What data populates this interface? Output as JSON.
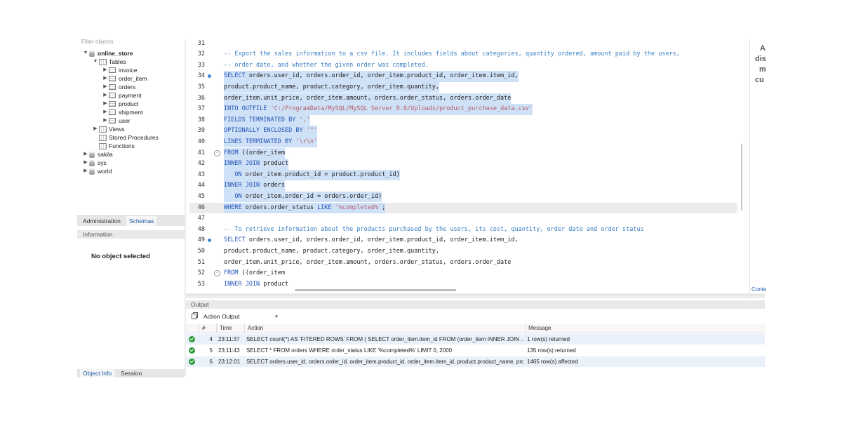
{
  "navigator": {
    "filter_placeholder": "Filter objects",
    "tree": [
      {
        "label": "online_store",
        "icon": "database-icon",
        "expanded": true,
        "bold": true
      },
      {
        "label": "Tables",
        "icon": "tables-folder-icon",
        "expanded": true
      },
      {
        "label": "invoice",
        "icon": "table-icon"
      },
      {
        "label": "order_item",
        "icon": "table-icon"
      },
      {
        "label": "orders",
        "icon": "table-icon"
      },
      {
        "label": "payment",
        "icon": "table-icon"
      },
      {
        "label": "product",
        "icon": "table-icon"
      },
      {
        "label": "shipment",
        "icon": "table-icon"
      },
      {
        "label": "user",
        "icon": "table-icon"
      },
      {
        "label": "Views",
        "icon": "views-folder-icon"
      },
      {
        "label": "Stored Procedures",
        "icon": "procedures-folder-icon"
      },
      {
        "label": "Functions",
        "icon": "functions-folder-icon"
      },
      {
        "label": "sakila",
        "icon": "database-icon"
      },
      {
        "label": "sys",
        "icon": "database-icon"
      },
      {
        "label": "world",
        "icon": "database-icon"
      }
    ],
    "tabs": [
      "Administration",
      "Schemas"
    ],
    "active_tab": "Schemas"
  },
  "information": {
    "header": "Information",
    "empty_text": "No object selected",
    "tabs": [
      "Object Info",
      "Session"
    ],
    "active_tab": "Object Info"
  },
  "editor": {
    "lines": [
      {
        "num": "31",
        "segs": []
      },
      {
        "num": "32",
        "segs": [
          {
            "t": "-- Export the sales information to a csv file. It includes fields about categories, quantity ordered, amount paid by the users,",
            "c": "cmt"
          }
        ]
      },
      {
        "num": "33",
        "segs": [
          {
            "t": "-- order date, and whether the given order was completed.",
            "c": "cmt"
          }
        ]
      },
      {
        "num": "34",
        "dot": true,
        "sel": true,
        "segs": [
          {
            "t": "SELECT",
            "c": "kw"
          },
          {
            "t": " orders.user_id, orders.order_id, order_item.product_id, order_item.item_id,"
          }
        ]
      },
      {
        "num": "35",
        "sel": true,
        "segs": [
          {
            "t": "product.product_name, product.category, order_item.quantity,"
          }
        ]
      },
      {
        "num": "36",
        "sel": true,
        "segs": [
          {
            "t": "order_item.unit_price, order_item.amount, orders.order_status, orders.order_date"
          }
        ]
      },
      {
        "num": "37",
        "sel": true,
        "segs": [
          {
            "t": "INTO OUTFILE",
            "c": "kw"
          },
          {
            "t": " "
          },
          {
            "t": "'C:/ProgramData/MySQL/MySQL Server 8.0/Uploads/product_purchase_data.csv'",
            "c": "str"
          }
        ]
      },
      {
        "num": "38",
        "sel": true,
        "segs": [
          {
            "t": "FIELDS TERMINATED BY",
            "c": "kw"
          },
          {
            "t": " "
          },
          {
            "t": "','",
            "c": "str"
          }
        ]
      },
      {
        "num": "39",
        "sel": true,
        "segs": [
          {
            "t": "OPTIONALLY ENCLOSED BY",
            "c": "kw"
          },
          {
            "t": " "
          },
          {
            "t": "'\"'",
            "c": "str"
          }
        ]
      },
      {
        "num": "40",
        "sel": true,
        "segs": [
          {
            "t": "LINES TERMINATED BY",
            "c": "kw"
          },
          {
            "t": " "
          },
          {
            "t": "'\\r\\n'",
            "c": "str"
          }
        ]
      },
      {
        "num": "41",
        "fold": true,
        "sel": true,
        "segs": [
          {
            "t": "FROM",
            "c": "kw"
          },
          {
            "t": " ((order_item"
          }
        ]
      },
      {
        "num": "42",
        "sel": true,
        "segs": [
          {
            "t": "INNER JOIN",
            "c": "kw"
          },
          {
            "t": " product"
          }
        ]
      },
      {
        "num": "43",
        "sel": true,
        "segs": [
          {
            "t": "   "
          },
          {
            "t": "ON",
            "c": "kw"
          },
          {
            "t": " order_item.product_id = product.product_id)"
          }
        ]
      },
      {
        "num": "44",
        "sel": true,
        "segs": [
          {
            "t": "INNER JOIN",
            "c": "kw"
          },
          {
            "t": " orders"
          }
        ]
      },
      {
        "num": "45",
        "sel": true,
        "segs": [
          {
            "t": "   "
          },
          {
            "t": "ON",
            "c": "kw"
          },
          {
            "t": " order_item.order_id = orders.order_id)"
          }
        ]
      },
      {
        "num": "46",
        "sel": true,
        "current": true,
        "segs": [
          {
            "t": "WHERE",
            "c": "kw"
          },
          {
            "t": " orders.order_status "
          },
          {
            "t": "LIKE",
            "c": "kw"
          },
          {
            "t": " "
          },
          {
            "t": "'%completed%'",
            "c": "str"
          },
          {
            "t": ";"
          }
        ]
      },
      {
        "num": "47",
        "segs": []
      },
      {
        "num": "48",
        "segs": [
          {
            "t": "-- To retrieve information about the products purchased by the users, its cost, quantity, order date and order status",
            "c": "cmt"
          }
        ]
      },
      {
        "num": "49",
        "dot": true,
        "segs": [
          {
            "t": "SELECT",
            "c": "kw"
          },
          {
            "t": " orders.user_id, orders.order_id, order_item.product_id, order_item.item_id,"
          }
        ]
      },
      {
        "num": "50",
        "segs": [
          {
            "t": "product.product_name, product.category, order_item.quantity,"
          }
        ]
      },
      {
        "num": "51",
        "segs": [
          {
            "t": "order_item.unit_price, order_item.amount, orders.order_status, orders.order_date"
          }
        ]
      },
      {
        "num": "52",
        "fold": true,
        "segs": [
          {
            "t": "FROM",
            "c": "kw"
          },
          {
            "t": " ((order_item"
          }
        ]
      },
      {
        "num": "53",
        "segs": [
          {
            "t": "INNER JOIN",
            "c": "kw"
          },
          {
            "t": " product"
          }
        ]
      }
    ]
  },
  "side_panel": {
    "text_lines": [
      "A",
      "dis",
      "m",
      "cu"
    ],
    "tab": "Conte"
  },
  "output": {
    "header": "Output",
    "selector": "Action Output",
    "columns": [
      "#",
      "Time",
      "Action",
      "Message"
    ],
    "rows": [
      {
        "num": "4",
        "time": "23:11:37",
        "action": "SELECT count(*) AS 'FITERED ROWS'  FROM ( SELECT order_item.item_id FROM (order_item INNER JOIN ...",
        "message": "1 row(s) returned"
      },
      {
        "num": "5",
        "time": "23:11:43",
        "action": "SELECT * FROM orders WHERE order_status LIKE '%completed%' LIMIT 0, 2000",
        "message": "135 row(s) returned"
      },
      {
        "num": "6",
        "time": "23:12:01",
        "action": "SELECT orders.user_id, orders.order_id, order_item.product_id, order_item.item_id, product.product_name, pro...",
        "message": "1465 row(s) affected"
      }
    ]
  },
  "colors": {
    "selection": "#cfe1f6",
    "comment": "#3a7fc2",
    "keyword": "#2253b8",
    "string": "#b55a6a",
    "success": "#2f9a3a"
  }
}
